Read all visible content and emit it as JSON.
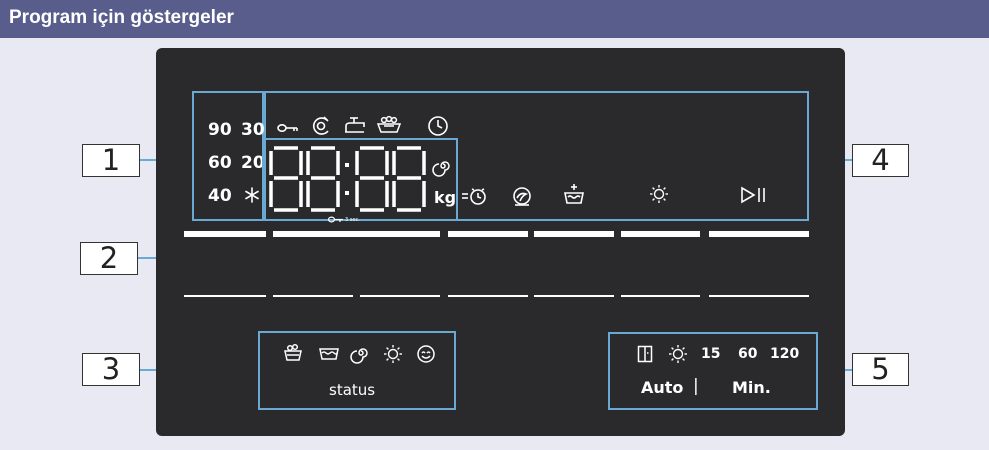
{
  "header": {
    "title": "Program için göstergeler"
  },
  "temperature_group": {
    "t90": "90",
    "t30": "30",
    "t60": "60",
    "t20": "20",
    "t40": "40"
  },
  "display": {
    "unit": "kg",
    "lock_hint": "3 sec."
  },
  "status_group": {
    "label": "status"
  },
  "time_group": {
    "v15": "15",
    "v60": "60",
    "v120": "120",
    "auto": "Auto",
    "separator": "|",
    "min": "Min."
  },
  "callouts": [
    "1",
    "2",
    "3",
    "4",
    "5"
  ],
  "icons": {
    "temperature": [
      "snowflake-icon"
    ],
    "function": [
      "key-lock-icon",
      "child-lock-icon",
      "water-tap-icon",
      "laundry-basket-icon",
      "clock-icon"
    ],
    "display": [
      "spin-icon"
    ],
    "lower_function": [
      "timer-icon",
      "anti-crease-icon",
      "extra-rinse-icon",
      "drying-icon",
      "start-pause-icon"
    ],
    "status": [
      "prewash-icon",
      "wash-icon",
      "spin-icon",
      "drying-icon",
      "done-icon"
    ],
    "time": [
      "door-icon",
      "drying-icon"
    ]
  },
  "colors": {
    "header": "#595d8c",
    "background": "#e9e9f4",
    "panel": "#2a2a2c",
    "frame": "#6aa9d4"
  }
}
